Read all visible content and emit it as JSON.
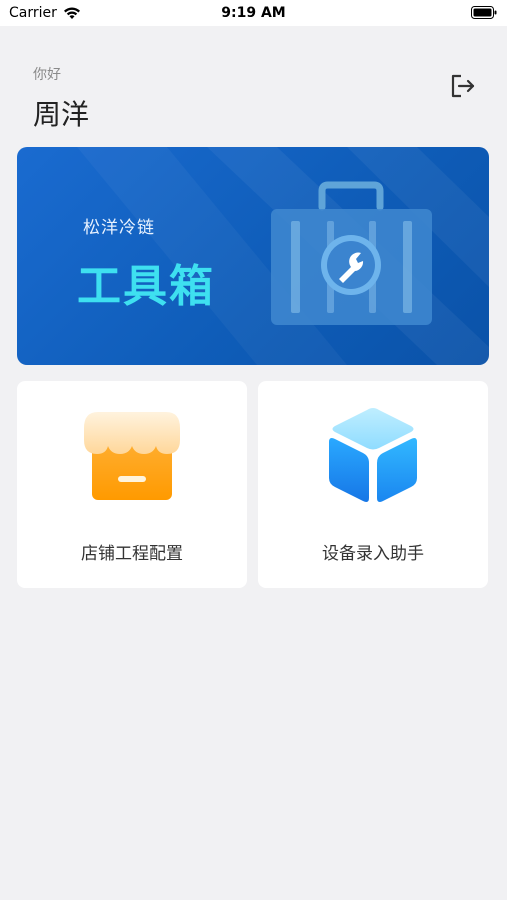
{
  "status_bar": {
    "carrier": "Carrier",
    "time": "9:19 AM"
  },
  "header": {
    "greeting": "你好",
    "user_name": "周洋",
    "logout_icon": "logout-icon"
  },
  "banner": {
    "subtitle": "松洋冷链",
    "title": "工具箱",
    "icon": "toolbox-icon",
    "title_color": "#3ee0f0",
    "background_color": "#1466c8"
  },
  "cards": [
    {
      "label": "店铺工程配置",
      "icon": "store-icon"
    },
    {
      "label": "设备录入助手",
      "icon": "cube-icon"
    }
  ],
  "colors": {
    "page_background": "#f1f1f3",
    "card_background": "#ffffff"
  }
}
